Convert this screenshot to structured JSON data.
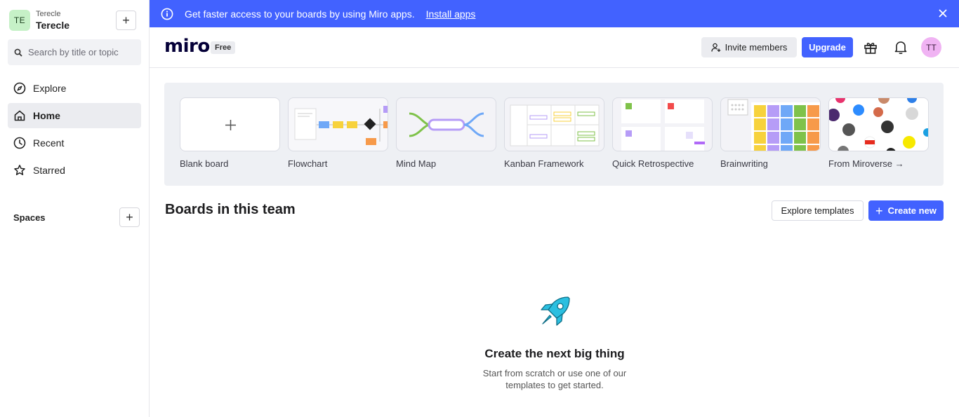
{
  "sidebar": {
    "team": {
      "initials": "TE",
      "org": "Terecle",
      "name": "Terecle",
      "add": "+"
    },
    "search_placeholder": "Search by title or topic",
    "nav": [
      {
        "label": "Explore",
        "icon": "compass-icon"
      },
      {
        "label": "Home",
        "icon": "home-icon",
        "active": true
      },
      {
        "label": "Recent",
        "icon": "clock-icon"
      },
      {
        "label": "Starred",
        "icon": "star-icon"
      }
    ],
    "spaces_label": "Spaces",
    "spaces_add": "+"
  },
  "banner": {
    "text": "Get faster access to your boards by using Miro apps.",
    "link": "Install apps",
    "color": "#4262ff"
  },
  "header": {
    "logo": "miro",
    "plan": "Free",
    "invite_label": "Invite members",
    "upgrade_label": "Upgrade",
    "user_initials": "TT"
  },
  "templates": [
    {
      "label": "Blank board"
    },
    {
      "label": "Flowchart"
    },
    {
      "label": "Mind Map"
    },
    {
      "label": "Kanban Framework"
    },
    {
      "label": "Quick Retrospective"
    },
    {
      "label": "Brainwriting"
    },
    {
      "label": "From Miroverse →"
    }
  ],
  "boards": {
    "title": "Boards in this team",
    "explore_label": "Explore templates",
    "create_label": "Create new",
    "create_plus": "+"
  },
  "empty_state": {
    "title": "Create the next big thing",
    "subtitle": "Start from scratch or use one of our templates to get started."
  },
  "colors": {
    "accent": "#4262ff",
    "rocket": "#2bbfe0"
  }
}
